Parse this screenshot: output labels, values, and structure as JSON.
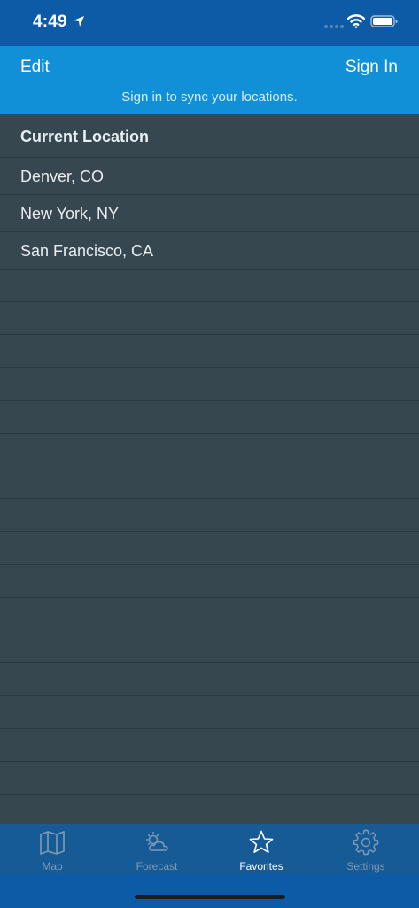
{
  "status_bar": {
    "time": "4:49"
  },
  "header": {
    "edit_label": "Edit",
    "sign_in_label": "Sign In",
    "subtitle": "Sign in to sync your locations."
  },
  "locations": {
    "section_label": "Current Location",
    "items": [
      {
        "label": "Denver, CO"
      },
      {
        "label": "New York, NY"
      },
      {
        "label": "San Francisco, CA"
      }
    ]
  },
  "tabs": [
    {
      "label": "Map",
      "icon": "map-icon"
    },
    {
      "label": "Forecast",
      "icon": "forecast-icon"
    },
    {
      "label": "Favorites",
      "icon": "star-icon",
      "active": true
    },
    {
      "label": "Settings",
      "icon": "gear-icon"
    }
  ],
  "colors": {
    "status_bar": "#0d5aa7",
    "header": "#1190d8",
    "list_background": "#37474f",
    "tab_bar": "#165a96",
    "tab_inactive": "#7f9bb5",
    "tab_active": "#ffffff"
  }
}
